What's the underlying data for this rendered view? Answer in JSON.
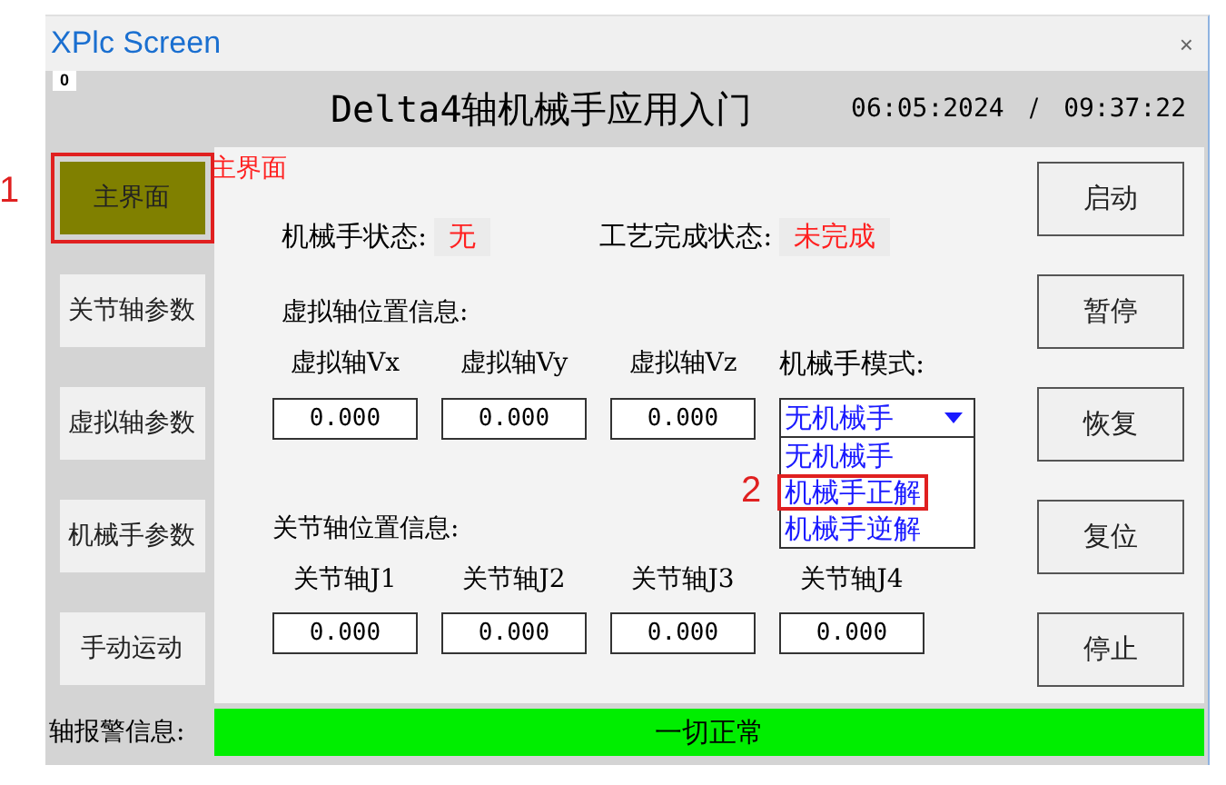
{
  "window": {
    "title": "XPlc Screen",
    "close": "×"
  },
  "header": {
    "badge": "0",
    "title": "Delta4轴机械手应用入门",
    "date": "06:05:2024",
    "separator": "/",
    "time": "09:37:22"
  },
  "sidebar": {
    "items": [
      {
        "label": "主界面",
        "selected": true,
        "callout": "1"
      },
      {
        "label": "关节轴参数",
        "selected": false
      },
      {
        "label": "虚拟轴参数",
        "selected": false
      },
      {
        "label": "机械手参数",
        "selected": false
      },
      {
        "label": "手动运动",
        "selected": false
      }
    ]
  },
  "page_label": "主界面",
  "status": [
    {
      "label": "机械手状态:",
      "value": "无"
    },
    {
      "label": "工艺完成状态:",
      "value": "未完成"
    }
  ],
  "virtual_axis": {
    "heading": "虚拟轴位置信息:",
    "fields": [
      {
        "label": "虚拟轴Vx",
        "value": "0.000"
      },
      {
        "label": "虚拟轴Vy",
        "value": "0.000"
      },
      {
        "label": "虚拟轴Vz",
        "value": "0.000"
      }
    ]
  },
  "robot_mode": {
    "label": "机械手模式:",
    "value": "无机械手",
    "expanded": true,
    "options": [
      {
        "label": "无机械手"
      },
      {
        "label": "机械手正解",
        "callout": "2"
      },
      {
        "label": "机械手逆解"
      }
    ]
  },
  "joint_axis": {
    "heading": "关节轴位置信息:",
    "fields": [
      {
        "label": "关节轴J1",
        "value": "0.000"
      },
      {
        "label": "关节轴J2",
        "value": "0.000"
      },
      {
        "label": "关节轴J3",
        "value": "0.000"
      },
      {
        "label": "关节轴J4",
        "value": "0.000"
      }
    ]
  },
  "buttons": [
    "启动",
    "暂停",
    "恢复",
    "复位",
    "停止"
  ],
  "alarm": {
    "label": "轴报警信息:",
    "message": "一切正常",
    "ok": true
  }
}
